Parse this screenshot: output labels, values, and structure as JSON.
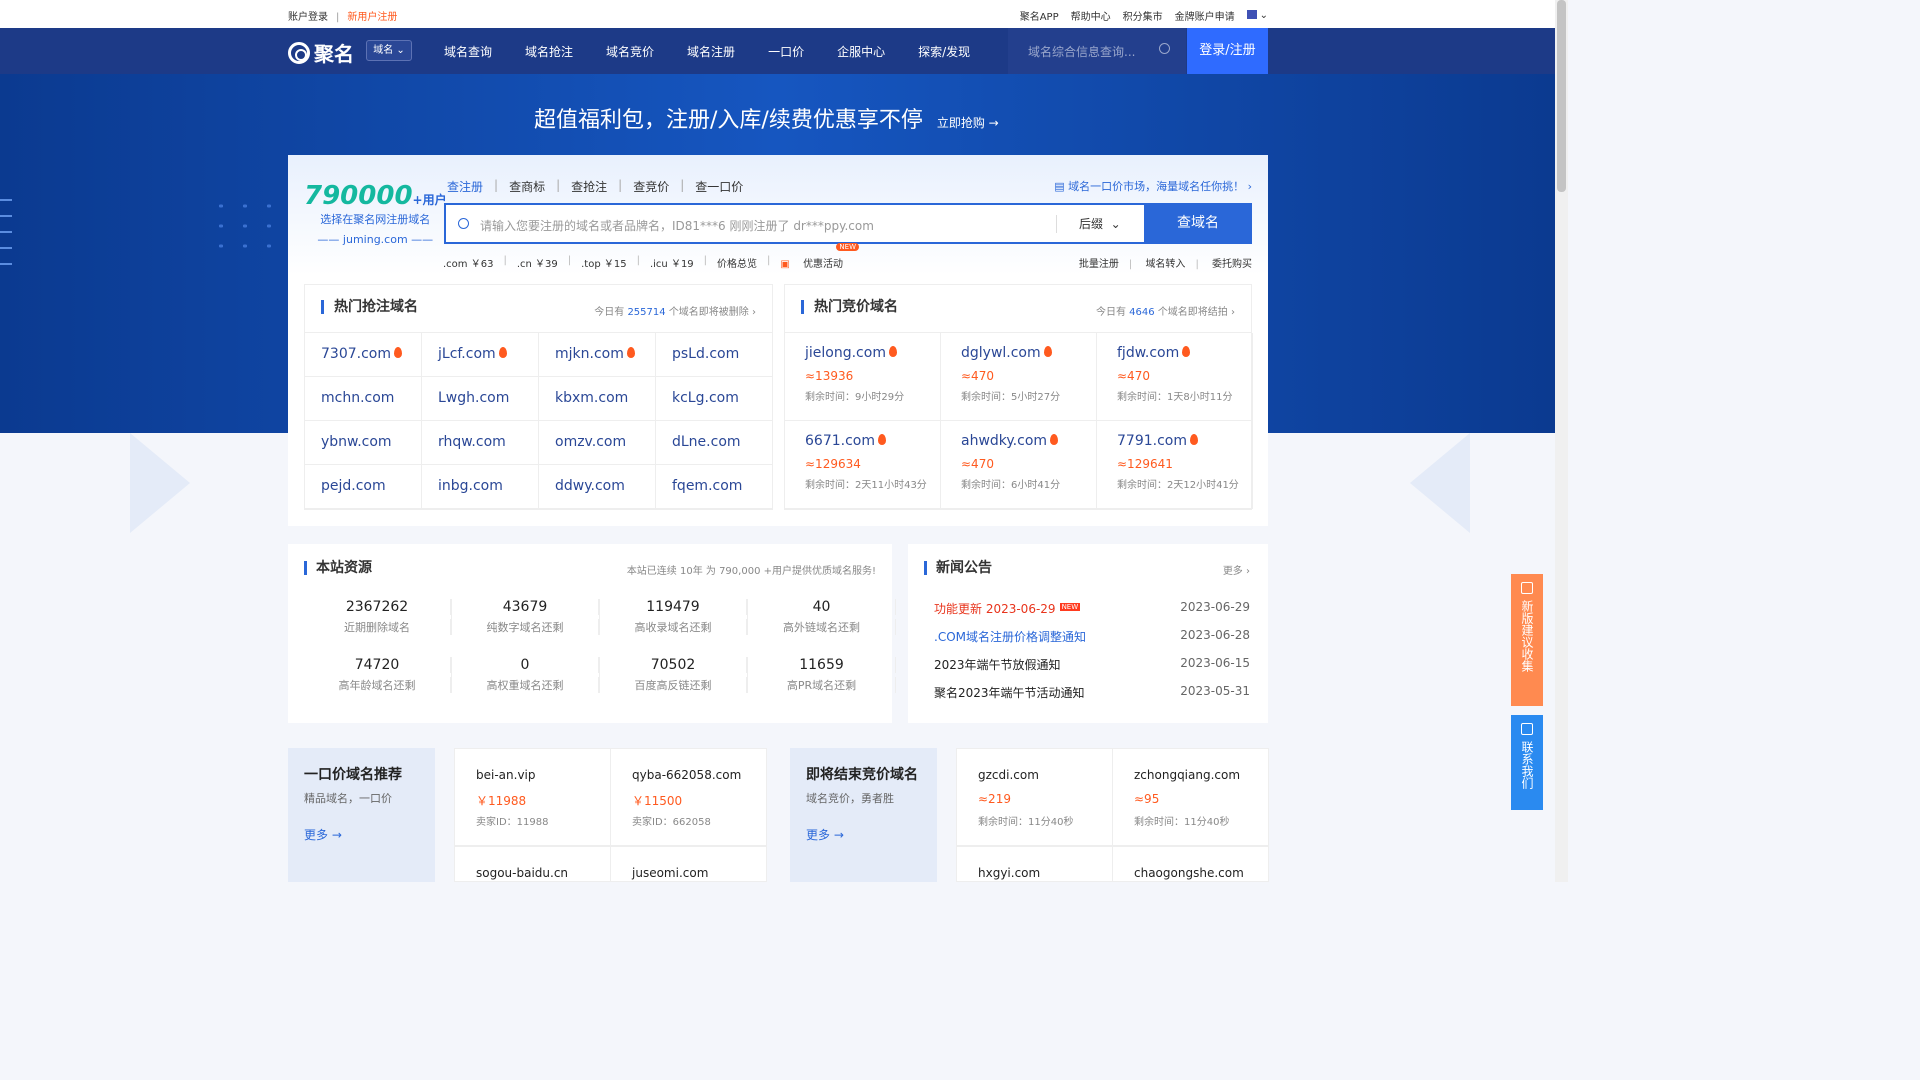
{
  "topbar": {
    "login": "账户登录",
    "register": "新用户注册",
    "links": [
      "聚名APP",
      "帮助中心",
      "积分集市",
      "金牌账户申请"
    ]
  },
  "nav": {
    "brand": "聚名",
    "domain_select": "域名",
    "menu": [
      "域名查询",
      "域名抢注",
      "域名竞价",
      "域名注册",
      "一口价",
      "企服中心",
      "探索/发现"
    ],
    "search_placeholder": "域名综合信息查询...",
    "login": "登录/注册"
  },
  "hero": {
    "slogan": "超值福利包，注册/入库/续费优惠享不停",
    "cta": "立即抢购 →"
  },
  "stat": {
    "number": "790000",
    "suffix": "+用户",
    "line1": "选择在聚名网注册域名",
    "line2": "—— juming.com ——"
  },
  "search": {
    "tabs": [
      "查注册",
      "查商标",
      "查抢注",
      "查竞价",
      "查一口价"
    ],
    "market_link": "域名一口价市场，海量域名任你挑！",
    "placeholder": "请输入您要注册的域名或者品牌名，ID81***6 刚刚注册了 dr***ppy.com",
    "suffix": "后缀",
    "button": "查域名",
    "prices": [
      ".com ￥63",
      ".cn ￥39",
      ".top ￥15",
      ".icu ￥19",
      "价格总览"
    ],
    "activity": "优惠活动",
    "new": "NEW",
    "tools": [
      "批量注册",
      "域名转入",
      "委托购买"
    ]
  },
  "hot_snatch": {
    "title": "热门抢注域名",
    "info_pre": "今日有",
    "count": "255714",
    "info_post": "个域名即将被删除",
    "items": [
      [
        "7307.com",
        true
      ],
      [
        "jLcf.com",
        true
      ],
      [
        "mjkn.com",
        true
      ],
      [
        "psLd.com",
        false
      ],
      [
        "mchn.com",
        false
      ],
      [
        "Lwgh.com",
        false
      ],
      [
        "kbxm.com",
        false
      ],
      [
        "kcLg.com",
        false
      ],
      [
        "ybnw.com",
        false
      ],
      [
        "rhqw.com",
        false
      ],
      [
        "omzv.com",
        false
      ],
      [
        "dLne.com",
        false
      ],
      [
        "pejd.com",
        false
      ],
      [
        "inbg.com",
        false
      ],
      [
        "ddwy.com",
        false
      ],
      [
        "fqem.com",
        false
      ]
    ]
  },
  "hot_auction": {
    "title": "热门竞价域名",
    "info_pre": "今日有",
    "count": "4646",
    "info_post": "个域名即将结拍",
    "items": [
      {
        "name": "jielong.com",
        "price": "≈13936",
        "left": "剩余时间：9小时29分"
      },
      {
        "name": "dglywl.com",
        "price": "≈470",
        "left": "剩余时间：5小时27分"
      },
      {
        "name": "fjdw.com",
        "price": "≈470",
        "left": "剩余时间：1天8小时11分"
      },
      {
        "name": "6671.com",
        "price": "≈129634",
        "left": "剩余时间：2天11小时43分"
      },
      {
        "name": "ahwdky.com",
        "price": "≈470",
        "left": "剩余时间：6小时41分"
      },
      {
        "name": "7791.com",
        "price": "≈129641",
        "left": "剩余时间：2天12小时41分"
      }
    ]
  },
  "resources": {
    "title": "本站资源",
    "note": "本站已连续 10年 为 790,000 +用户提供优质域名服务!",
    "items": [
      {
        "v": "2367262",
        "k": "近期删除域名"
      },
      {
        "v": "43679",
        "k": "纯数字域名还剩"
      },
      {
        "v": "119479",
        "k": "高收录域名还剩"
      },
      {
        "v": "40",
        "k": "高外链域名还剩"
      },
      {
        "v": "74720",
        "k": "高年龄域名还剩"
      },
      {
        "v": "0",
        "k": "高权重域名还剩"
      },
      {
        "v": "70502",
        "k": "百度高反链还剩"
      },
      {
        "v": "11659",
        "k": "高PR域名还剩"
      }
    ]
  },
  "news": {
    "title": "新闻公告",
    "more": "更多",
    "items": [
      {
        "t": "功能更新 2023-06-29",
        "d": "2023-06-29",
        "c": "#e8341c",
        "new": true
      },
      {
        "t": ".COM域名注册价格调整通知",
        "d": "2023-06-28",
        "c": "#2a67d8"
      },
      {
        "t": "2023年端午节放假通知",
        "d": "2023-06-15",
        "c": "#222"
      },
      {
        "t": "聚名2023年端午节活动通知",
        "d": "2023-05-31",
        "c": "#222"
      }
    ]
  },
  "fixed_price": {
    "title": "一口价域名推荐",
    "sub": "精品域名，一口价",
    "more": "更多 →",
    "cards": [
      {
        "n": "bei-an.vip",
        "p": "￥11988",
        "x": "卖家ID：11988"
      },
      {
        "n": "qyba-662058.com",
        "p": "￥11500",
        "x": "卖家ID：662058"
      },
      {
        "n": "sogou-baidu.cn"
      },
      {
        "n": "juseomi.com"
      }
    ]
  },
  "ending": {
    "title": "即将结束竞价域名",
    "sub": "域名竞价，勇者胜",
    "more": "更多 →",
    "cards": [
      {
        "n": "gzcdi.com",
        "p": "≈219",
        "x": "剩余时间：11分40秒"
      },
      {
        "n": "zchongqiang.com",
        "p": "≈95",
        "x": "剩余时间：11分40秒"
      },
      {
        "n": "hxgyi.com"
      },
      {
        "n": "chaogongshe.com"
      }
    ]
  },
  "side": {
    "feedback": "新版建议收集",
    "contact": "联系我们"
  }
}
